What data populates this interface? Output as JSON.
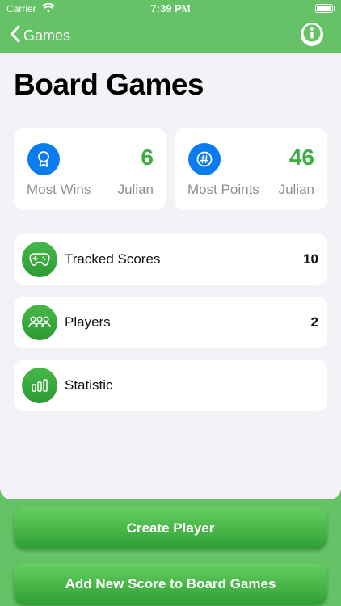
{
  "status_bar": {
    "carrier": "Carrier",
    "time": "7:39 PM"
  },
  "nav": {
    "back_label": "Games"
  },
  "page": {
    "title": "Board Games"
  },
  "stats": [
    {
      "label": "Most Wins",
      "value": "6",
      "player": "Julian",
      "icon": "ribbon-award-icon"
    },
    {
      "label": "Most Points",
      "value": "46",
      "player": "Julian",
      "icon": "number-sign-icon"
    }
  ],
  "rows": [
    {
      "label": "Tracked Scores",
      "count": "10",
      "icon": "gamepad-icon"
    },
    {
      "label": "Players",
      "count": "2",
      "icon": "people-icon"
    },
    {
      "label": "Statistic",
      "count": "",
      "icon": "bar-chart-icon"
    }
  ],
  "actions": {
    "create_player": "Create Player",
    "add_score": "Add New Score to Board Games"
  },
  "colors": {
    "accent_green": "#66c267",
    "value_green": "#3cae3f",
    "badge_blue": "#0a7cf0",
    "background": "#f2f2f7"
  }
}
